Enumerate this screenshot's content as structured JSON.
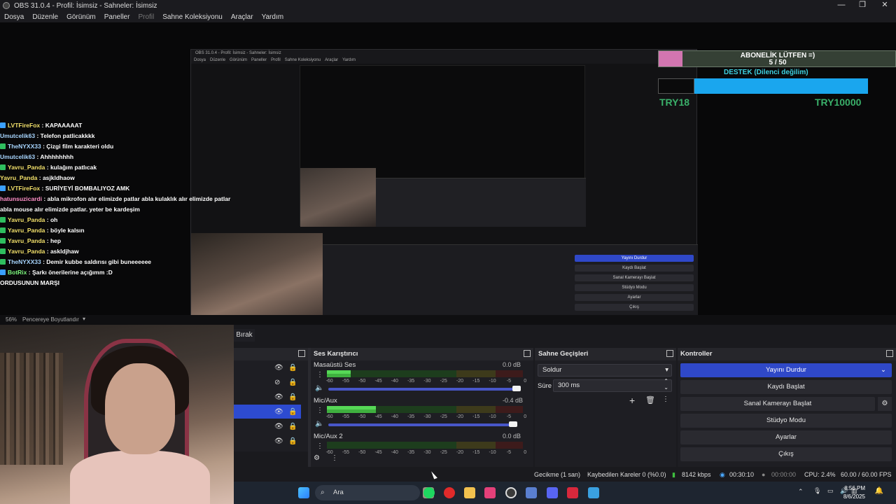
{
  "window": {
    "title": "OBS 31.0.4 - Profil: İsimsiz - Sahneler: İsimsiz",
    "minimize": "—",
    "maximize": "❐",
    "close": "✕"
  },
  "menu": [
    "Dosya",
    "Düzenle",
    "Görünüm",
    "Paneller",
    "Profil",
    "Sahne Koleksiyonu",
    "Araçlar",
    "Yardım"
  ],
  "nested": {
    "title": "OBS 31.0.4 - Profil: İsimsiz - Sahneler: İsimsiz",
    "menu": [
      "Dosya",
      "Düzenle",
      "Görünüm",
      "Paneller",
      "Profil",
      "Sahne Koleksiyonu",
      "Araçlar",
      "Yardım"
    ],
    "controls": [
      "Yayını Durdur",
      "Kaydı Başlat",
      "Sanal Kamerayı Başlat",
      "Stüdyo Modu",
      "Ayarlar",
      "Çıkış"
    ],
    "zoom": "56%",
    "fit": "Pencereye Boyutlandır"
  },
  "chat": [
    {
      "badge": "blue",
      "user": "LVTFireFox",
      "ucolor": "u-yellow",
      "text": "KAPAAAAAT"
    },
    {
      "badge": "",
      "user": "Umutcelik63",
      "ucolor": "u-blue",
      "text": "Telefon patlicakkkk"
    },
    {
      "badge": "green",
      "user": "TheNYXX33",
      "ucolor": "u-blue",
      "text": "Çizgi film karakteri oldu"
    },
    {
      "badge": "",
      "user": "Umutcelik63",
      "ucolor": "u-blue",
      "text": "Ahhhhhhhh"
    },
    {
      "badge": "green",
      "user": "Yavru_Panda",
      "ucolor": "u-yellow",
      "text": "kulağım patlıcak"
    },
    {
      "badge": "",
      "user": "Yavru_Panda",
      "ucolor": "u-yellow",
      "text": "asjkldhaow"
    },
    {
      "badge": "blue",
      "user": "LVTFireFox",
      "ucolor": "u-yellow",
      "text": "SURİYEYİ BOMBALIYOZ AMK"
    },
    {
      "badge": "",
      "user": "hatunsuzicardi",
      "ucolor": "u-pink",
      "text": "abla mikrofon alır elimizde patlar abla kulaklık alır elimizde patlar"
    },
    {
      "badge": "",
      "user": "",
      "ucolor": "",
      "text": "abla mouse alır elimizde patlar. yeter be kardeşim"
    },
    {
      "badge": "green",
      "user": "Yavru_Panda",
      "ucolor": "u-yellow",
      "text": "oh"
    },
    {
      "badge": "green",
      "user": "Yavru_Panda",
      "ucolor": "u-yellow",
      "text": "böyle kalsın"
    },
    {
      "badge": "green",
      "user": "Yavru_Panda",
      "ucolor": "u-yellow",
      "text": "hep"
    },
    {
      "badge": "green",
      "user": "Yavru_Panda",
      "ucolor": "u-yellow",
      "text": "askldjhaw"
    },
    {
      "badge": "green",
      "user": "TheNYXX33",
      "ucolor": "u-blue",
      "text": "Demir kubbe saldırısı gibi buneeeeee"
    },
    {
      "badge": "blue",
      "user": "BotRix",
      "ucolor": "u-green",
      "text": "Şarkı önerilerine açığımm :D"
    },
    {
      "badge": "",
      "user": "",
      "ucolor": "",
      "text": "ORDUSUNUN MARŞI"
    }
  ],
  "overlay": {
    "sub_title": "ABONELİK LÜTFEN =)",
    "sub_count": "5 / 50",
    "sub_progress": 0.1,
    "destek_title": "DESTEK (Dilenci değilim)",
    "destek_progress": 0.0018,
    "try_current": "TRY18",
    "try_goal": "TRY10000"
  },
  "preview_bar": {
    "zoom": "56%",
    "fit": "Pencereye Boyutlandır"
  },
  "scene_tab": "Bırak",
  "sources": [
    {
      "visible": true,
      "locked": true,
      "selected": false
    },
    {
      "visible": false,
      "locked": true,
      "selected": false
    },
    {
      "visible": true,
      "locked": true,
      "selected": false
    },
    {
      "visible": true,
      "locked": true,
      "selected": true
    },
    {
      "visible": true,
      "locked": true,
      "selected": false
    },
    {
      "visible": true,
      "locked": true,
      "selected": false
    }
  ],
  "mixer": {
    "title": "Ses Karıştırıcı",
    "scale": [
      "-60",
      "-55",
      "-50",
      "-45",
      "-40",
      "-35",
      "-30",
      "-25",
      "-20",
      "-15",
      "-10",
      "-5",
      "0"
    ],
    "channels": [
      {
        "name": "Masaüstü Ses",
        "db": "0.0 dB",
        "level": 0.12,
        "volume": 1.0
      },
      {
        "name": "Mic/Aux",
        "db": "-0.4 dB",
        "level": 0.25,
        "volume": 0.98
      },
      {
        "name": "Mic/Aux 2",
        "db": "0.0 dB",
        "level": 0.0,
        "volume": 1.0
      }
    ]
  },
  "transitions": {
    "title": "Sahne Geçişleri",
    "selected": "Soldur",
    "duration_label": "Süre",
    "duration": "300 ms"
  },
  "controls": {
    "title": "Kontroller",
    "stop_stream": "Yayını Durdur",
    "start_record": "Kaydı Başlat",
    "start_virtualcam": "Sanal Kamerayı Başlat",
    "studio_mode": "Stüdyo Modu",
    "settings": "Ayarlar",
    "exit": "Çıkış"
  },
  "status": {
    "delay": "Gecikme (1 san)",
    "dropped": "Kaybedilen Kareler 0 (%0.0)",
    "bitrate": "8142 kbps",
    "live_time": "00:30:10",
    "rec_time": "00:00:00",
    "cpu": "CPU: 2.4%",
    "fps": "60.00 / 60.00 FPS"
  },
  "taskbar": {
    "search": "Ara",
    "time": "8:56 PM",
    "date": "8/6/2025"
  },
  "colors": {
    "accent": "#2f48c8",
    "meter_green": "#56d856",
    "overlay_pink": "#d275b0",
    "overlay_blue": "#1aa6ee"
  }
}
